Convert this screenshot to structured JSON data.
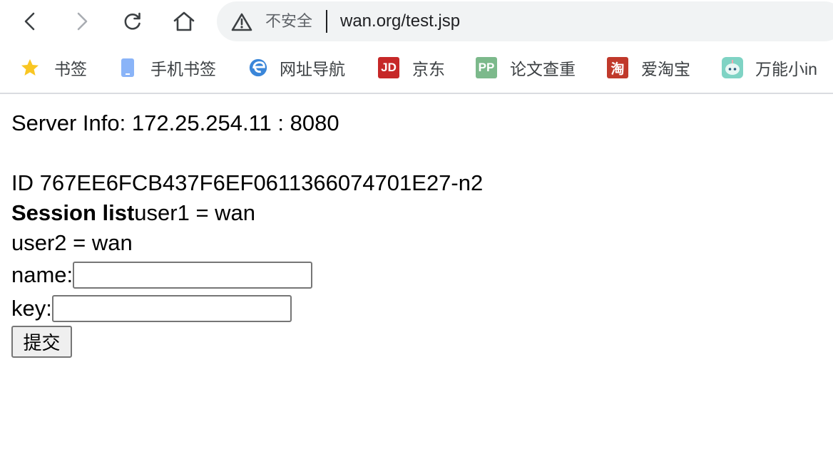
{
  "toolbar": {
    "security_text": "不安全",
    "url": "wan.org/test.jsp"
  },
  "bookmarks": [
    {
      "label": "书签",
      "icon": "star-icon"
    },
    {
      "label": "手机书签",
      "icon": "phone-icon"
    },
    {
      "label": "网址导航",
      "icon": "edge-icon"
    },
    {
      "label": "京东",
      "icon": "jd-icon",
      "icon_text": "JD"
    },
    {
      "label": "论文查重",
      "icon": "pp-icon",
      "icon_text": "PP"
    },
    {
      "label": "爱淘宝",
      "icon": "taobao-icon",
      "icon_text": "淘"
    },
    {
      "label": "万能小in",
      "icon": "robot-icon"
    }
  ],
  "page": {
    "server_info": "Server Info: 172.25.254.11 : 8080",
    "session_id": "ID 767EE6FCB437F6EF0611366074701E27-n2",
    "session_list_label": "Session list",
    "session_items": [
      "user1 = wan",
      "user2 = wan"
    ],
    "name_label": "name:",
    "name_value": "",
    "key_label": "key:",
    "key_value": "",
    "submit_label": "提交"
  },
  "colors": {
    "bookmark_star": "#f9c623",
    "phone": "#8ab4f8",
    "jd": "#c62828",
    "pp": "#7cb98b",
    "taobao": "#c0392b"
  }
}
